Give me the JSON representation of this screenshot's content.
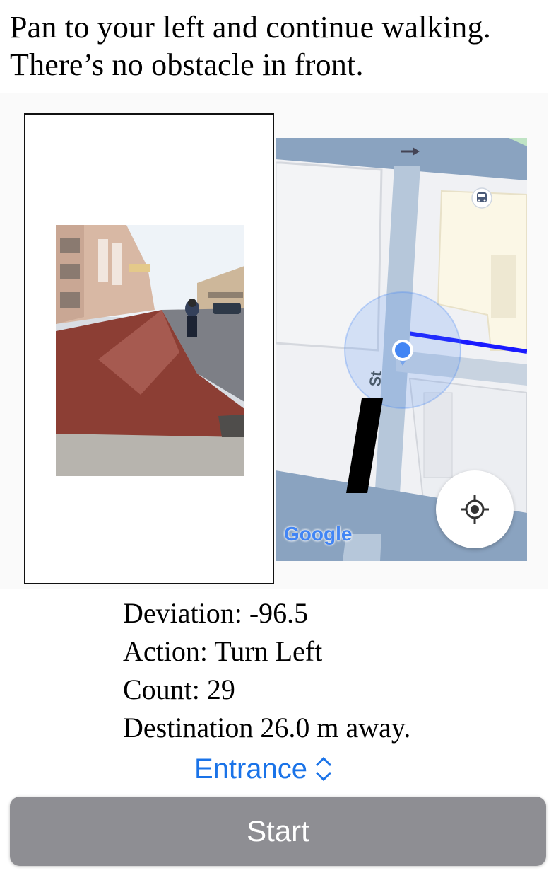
{
  "instruction": {
    "line1": "Pan to your left and continue walking.",
    "line2": "There’s no obstacle in front."
  },
  "map": {
    "street_label": "St",
    "google_logo": "Google",
    "icons": [
      "bus-stop-icon",
      "one-way-arrow-icon",
      "current-location-dot-icon",
      "my-location-icon"
    ],
    "route_color": "#1a1aff",
    "location_color": "#4285f4"
  },
  "readout": {
    "deviation": "Deviation: -96.5",
    "action": "Action: Turn Left",
    "count": "Count: 29",
    "destination": "Destination 26.0 m away."
  },
  "picker": {
    "selected": "Entrance",
    "icon": "chevron-up-down-icon"
  },
  "start_button": {
    "label": "Start"
  },
  "colors": {
    "link_blue": "#1a73e8",
    "button_gray": "#8e8e93"
  }
}
